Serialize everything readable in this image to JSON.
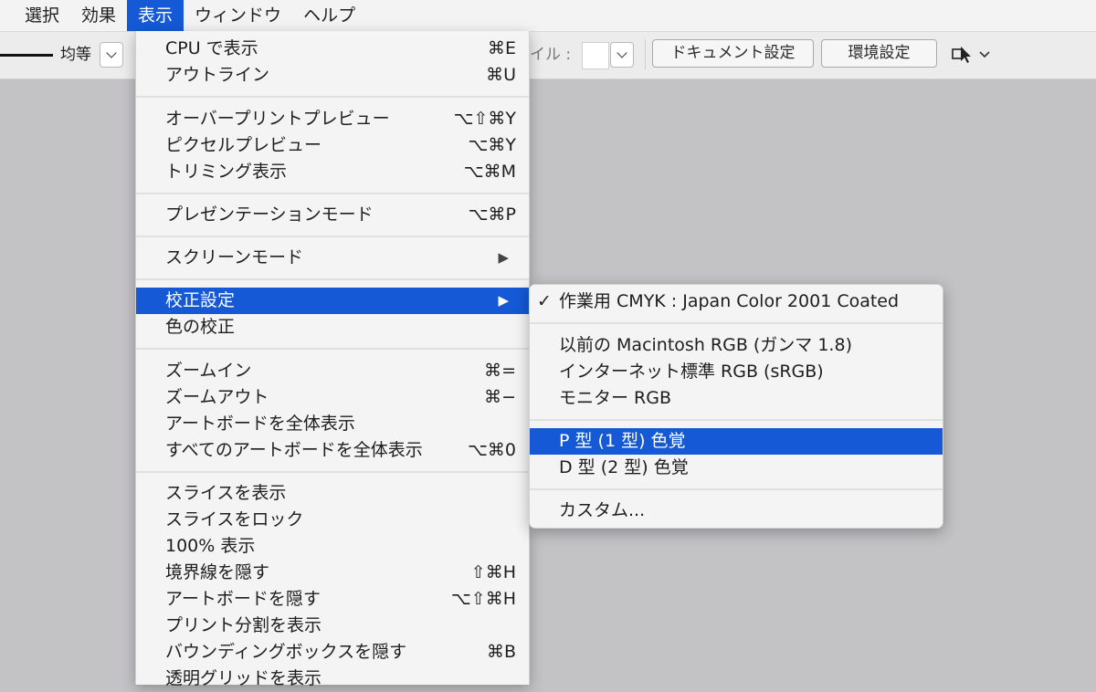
{
  "menubar": {
    "items": [
      "選択",
      "効果",
      "表示",
      "ウィンドウ",
      "ヘルプ"
    ],
    "active_index": 2
  },
  "controlbar": {
    "stroke_profile": "均等",
    "style_label": "イル :",
    "document_setup_button": "ドキュメント設定",
    "preferences_button": "環境設定"
  },
  "view_menu": {
    "items": [
      {
        "label": "CPU で表示",
        "shortcut": "⌘E"
      },
      {
        "label": "アウトライン",
        "shortcut": "⌘U"
      },
      {
        "label": "オーバープリントプレビュー",
        "shortcut": "⌥⇧⌘Y"
      },
      {
        "label": "ピクセルプレビュー",
        "shortcut": "⌥⌘Y"
      },
      {
        "label": "トリミング表示",
        "shortcut": "⌥⌘M"
      },
      {
        "label": "プレゼンテーションモード",
        "shortcut": "⌥⌘P"
      },
      {
        "label": "スクリーンモード",
        "shortcut": "",
        "submenu_arrow": "▶"
      },
      {
        "label": "校正設定",
        "shortcut": "",
        "submenu_arrow": "▶",
        "highlighted": true
      },
      {
        "label": "色の校正",
        "shortcut": ""
      },
      {
        "label": "ズームイン",
        "shortcut": "⌘="
      },
      {
        "label": "ズームアウト",
        "shortcut": "⌘−"
      },
      {
        "label": "アートボードを全体表示",
        "shortcut": ""
      },
      {
        "label": "すべてのアートボードを全体表示",
        "shortcut": "⌥⌘0"
      },
      {
        "label": "スライスを表示",
        "shortcut": ""
      },
      {
        "label": "スライスをロック",
        "shortcut": ""
      },
      {
        "label": "100% 表示",
        "shortcut": ""
      },
      {
        "label": "境界線を隠す",
        "shortcut": "⇧⌘H"
      },
      {
        "label": "アートボードを隠す",
        "shortcut": "⌥⇧⌘H"
      },
      {
        "label": "プリント分割を表示",
        "shortcut": ""
      },
      {
        "label": "バウンディングボックスを隠す",
        "shortcut": "⌘B"
      },
      {
        "label": "透明グリッドを表示",
        "shortcut": ""
      }
    ]
  },
  "proof_submenu": {
    "checkmark": "✓",
    "items": [
      {
        "label": "作業用 CMYK : Japan Color 2001 Coated",
        "checked": true
      },
      {
        "label": "以前の Macintosh RGB (ガンマ 1.8)"
      },
      {
        "label": "インターネット標準 RGB (sRGB)"
      },
      {
        "label": "モニター RGB"
      },
      {
        "label": "P 型 (1 型) 色覚",
        "highlighted": true
      },
      {
        "label": "D 型 (2 型) 色覚"
      },
      {
        "label": "カスタム..."
      }
    ]
  },
  "colors": {
    "accent": "#1559d6",
    "menu_bg": "#f4f4f4",
    "canvas_bg": "#c3c2c5"
  }
}
